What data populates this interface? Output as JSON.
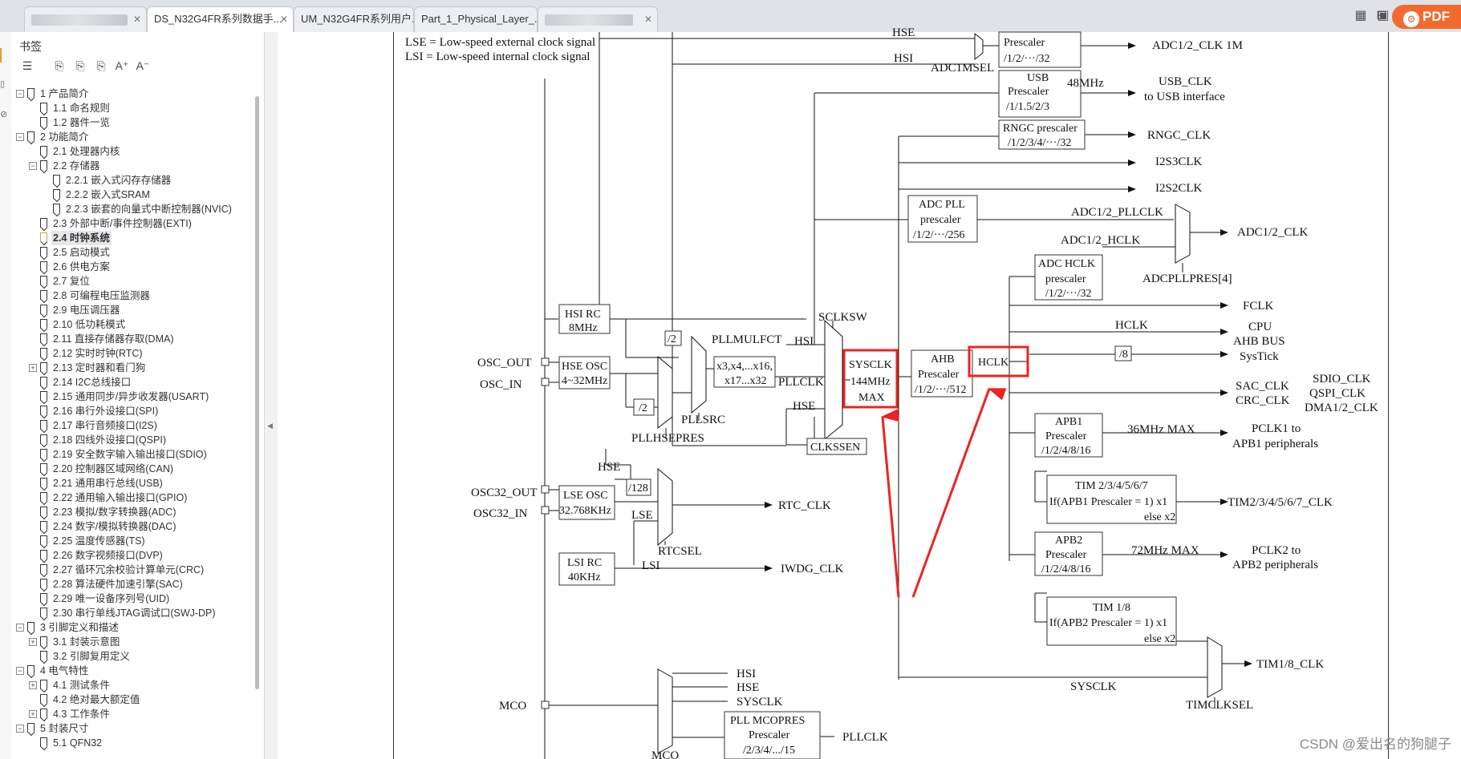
{
  "tabs": [
    {
      "label": "",
      "blurred": true
    },
    {
      "label": "DS_N32G4FR系列数据手...",
      "blurred": false
    },
    {
      "label": "UM_N32G4FR系列用户...",
      "blurred": false
    },
    {
      "label": "Part_1_Physical_Layer_...",
      "blurred": false
    },
    {
      "label": "",
      "blurred": true
    }
  ],
  "toolbar": {
    "pdf_label": "PDF"
  },
  "bookmarks": {
    "title": "书签",
    "items": [
      {
        "level": 0,
        "label": "1 产品简介",
        "expander": "−"
      },
      {
        "level": 1,
        "label": "1.1 命名规则"
      },
      {
        "level": 1,
        "label": "1.2 器件一览"
      },
      {
        "level": 0,
        "label": "2 功能简介",
        "expander": "−"
      },
      {
        "level": 1,
        "label": "2.1 处理器内核"
      },
      {
        "level": 1,
        "label": "2.2 存储器",
        "expander": "−"
      },
      {
        "level": 2,
        "label": "2.2.1 嵌入式闪存存储器"
      },
      {
        "level": 2,
        "label": "2.2.2 嵌入式SRAM"
      },
      {
        "level": 2,
        "label": "2.2.3 嵌套的向量式中断控制器(NVIC)"
      },
      {
        "level": 1,
        "label": "2.3 外部中断/事件控制器(EXTI)"
      },
      {
        "level": 1,
        "label": "2.4 时钟系统",
        "selected": true
      },
      {
        "level": 1,
        "label": "2.5 启动模式"
      },
      {
        "level": 1,
        "label": "2.6 供电方案"
      },
      {
        "level": 1,
        "label": "2.7 复位"
      },
      {
        "level": 1,
        "label": "2.8 可编程电压监测器"
      },
      {
        "level": 1,
        "label": "2.9 电压调压器"
      },
      {
        "level": 1,
        "label": "2.10 低功耗模式"
      },
      {
        "level": 1,
        "label": "2.11 直接存储器存取(DMA)"
      },
      {
        "level": 1,
        "label": "2.12 实时时钟(RTC)"
      },
      {
        "level": 1,
        "label": "2.13 定时器和看门狗",
        "expander": "+"
      },
      {
        "level": 1,
        "label": "2.14 I2C总线接口"
      },
      {
        "level": 1,
        "label": "2.15 通用同步/异步收发器(USART)"
      },
      {
        "level": 1,
        "label": "2.16 串行外设接口(SPI)"
      },
      {
        "level": 1,
        "label": "2.17 串行音频接口(I2S)"
      },
      {
        "level": 1,
        "label": "2.18 四线外设接口(QSPI)"
      },
      {
        "level": 1,
        "label": "2.19 安全数字输入输出接口(SDIO)"
      },
      {
        "level": 1,
        "label": "2.20 控制器区域网络(CAN)"
      },
      {
        "level": 1,
        "label": "2.21 通用串行总线(USB)"
      },
      {
        "level": 1,
        "label": "2.22 通用输入输出接口(GPIO)"
      },
      {
        "level": 1,
        "label": "2.23 模拟/数字转换器(ADC)"
      },
      {
        "level": 1,
        "label": "2.24 数字/模拟转换器(DAC)"
      },
      {
        "level": 1,
        "label": "2.25 温度传感器(TS)"
      },
      {
        "level": 1,
        "label": "2.26 数字视频接口(DVP)"
      },
      {
        "level": 1,
        "label": "2.27 循环冗余校验计算单元(CRC)"
      },
      {
        "level": 1,
        "label": "2.28 算法硬件加速引擎(SAC)"
      },
      {
        "level": 1,
        "label": "2.29 唯一设备序列号(UID)"
      },
      {
        "level": 1,
        "label": "2.30 串行单线JTAG调试口(SWJ-DP)"
      },
      {
        "level": 0,
        "label": "3 引脚定义和描述",
        "expander": "−"
      },
      {
        "level": 1,
        "label": "3.1 封装示意图",
        "expander": "+"
      },
      {
        "level": 1,
        "label": "3.2 引脚复用定义"
      },
      {
        "level": 0,
        "label": "4 电气特性",
        "expander": "−"
      },
      {
        "level": 1,
        "label": "4.1 测试条件",
        "expander": "+"
      },
      {
        "level": 1,
        "label": "4.2 绝对最大额定值"
      },
      {
        "level": 1,
        "label": "4.3 工作条件",
        "expander": "+"
      },
      {
        "level": 0,
        "label": "5 封装尺寸",
        "expander": "−"
      },
      {
        "level": 1,
        "label": "5.1 QFN32"
      }
    ]
  },
  "diagram": {
    "legend": [
      "LSE = Low-speed external clock signal",
      "LSI = Low-speed internal clock signal"
    ],
    "blocks": {
      "adc_1m": [
        "Prescaler",
        "/1/2/···/32"
      ],
      "usb": [
        "USB",
        "Prescaler",
        "/1/1.5/2/3"
      ],
      "rngc": [
        "RNGC prescaler",
        "/1/2/3/4/···/32"
      ],
      "adc_pll": [
        "ADC PLL",
        "prescaler",
        "/1/2/···/256"
      ],
      "adc_hclk": [
        "ADC HCLK",
        "prescaler",
        "/1/2/···/32"
      ],
      "hsi_rc": [
        "HSI RC",
        "8MHz"
      ],
      "hse_osc": [
        "HSE OSC",
        "4~32MHz"
      ],
      "pll_mul": [
        "x3,x4,...x16,",
        "x17...x32"
      ],
      "sysclk": [
        "SYSCLK",
        "144MHz",
        "MAX"
      ],
      "ahb": [
        "AHB",
        "Prescaler",
        "/1/2/···/512"
      ],
      "hclk": "HCLK",
      "clkssen": "CLKSSEN",
      "lse_osc": [
        "LSE OSC",
        "32.768KHz"
      ],
      "lsi_rc": [
        "LSI RC",
        "40KHz"
      ],
      "apb1": [
        "APB1",
        "Prescaler",
        "/1/2/4/8/16"
      ],
      "tim2": [
        "TIM 2/3/4/5/6/7",
        "If(APB1 Prescaler = 1) x1",
        "else x2"
      ],
      "apb2": [
        "APB2",
        "Prescaler",
        "/1/2/4/8/16"
      ],
      "tim1": [
        "TIM 1/8",
        "If(APB2 Prescaler = 1) x1",
        "else x2"
      ],
      "pll_mco": [
        "PLL MCOPRES",
        "Prescaler",
        "/2/3/4/.../15"
      ]
    },
    "labels": {
      "hse_top": "HSE",
      "hsi_top": "HSI",
      "adc1msel": "ADC1MSEL",
      "adc_1m_clk": "ADC1/2_CLK 1M",
      "usb_48": "48MHz",
      "usb_clk": "USB_CLK",
      "usb_if": "to USB interface",
      "rngc_clk": "RNGC_CLK",
      "i2s3": "I2S3CLK",
      "i2s2": "I2S2CLK",
      "adc_pllclk": "ADC1/2_PLLCLK",
      "adc_hclk_out": "ADC1/2_HCLK",
      "adc_clk": "ADC1/2_CLK",
      "adcpllpres": "ADCPLLPRES[4]",
      "fclk": "FCLK",
      "hclk_line": "HCLK",
      "cpu": "CPU",
      "ahb_bus": "AHB BUS",
      "systick": "SysTick",
      "div8": "/8",
      "sac": "SAC_CLK",
      "crc": "CRC_CLK",
      "sdio": "SDIO_CLK",
      "qspi": "QSPI_CLK",
      "dma": "DMA1/2_CLK",
      "apb1_max": "36MHz MAX",
      "pclk1": "PCLK1 to",
      "pclk1b": "APB1 peripherals",
      "tim2_clk": "TIM2/3/4/5/6/7_CLK",
      "apb2_max": "72MHz MAX",
      "pclk2": "PCLK2 to",
      "pclk2b": "APB2 peripherals",
      "tim1_clk": "TIM1/8_CLK",
      "timclksel": "TIMCLKSEL",
      "sysclk_bottom": "SYSCLK",
      "sclksw": "SCLKSW",
      "hsi_in": "HSI",
      "hse_in": "HSE",
      "pllclk": "PLLCLK",
      "pllmulfct": "PLLMULFCT",
      "pllsrc": "PLLSRC",
      "pllhsepres": "PLLHSEPRES",
      "div2a": "/2",
      "div2b": "/2",
      "osc_out": "OSC_OUT",
      "osc_in": "OSC_IN",
      "hse_rtc": "HSE",
      "div128": "/128",
      "lse": "LSE",
      "lsi": "LSI",
      "rtc_clk": "RTC_CLK",
      "rtcsel": "RTCSEL",
      "iwdg": "IWDG_CLK",
      "osc32_out": "OSC32_OUT",
      "osc32_in": "OSC32_IN",
      "mco": "MCO",
      "mco_hsi": "HSI",
      "mco_hse": "HSE",
      "mco_sys": "SYSCLK",
      "mco_pll": "PLLCLK",
      "mco_sel": "MCO"
    }
  },
  "watermark": "CSDN @爱出名的狗腿子"
}
